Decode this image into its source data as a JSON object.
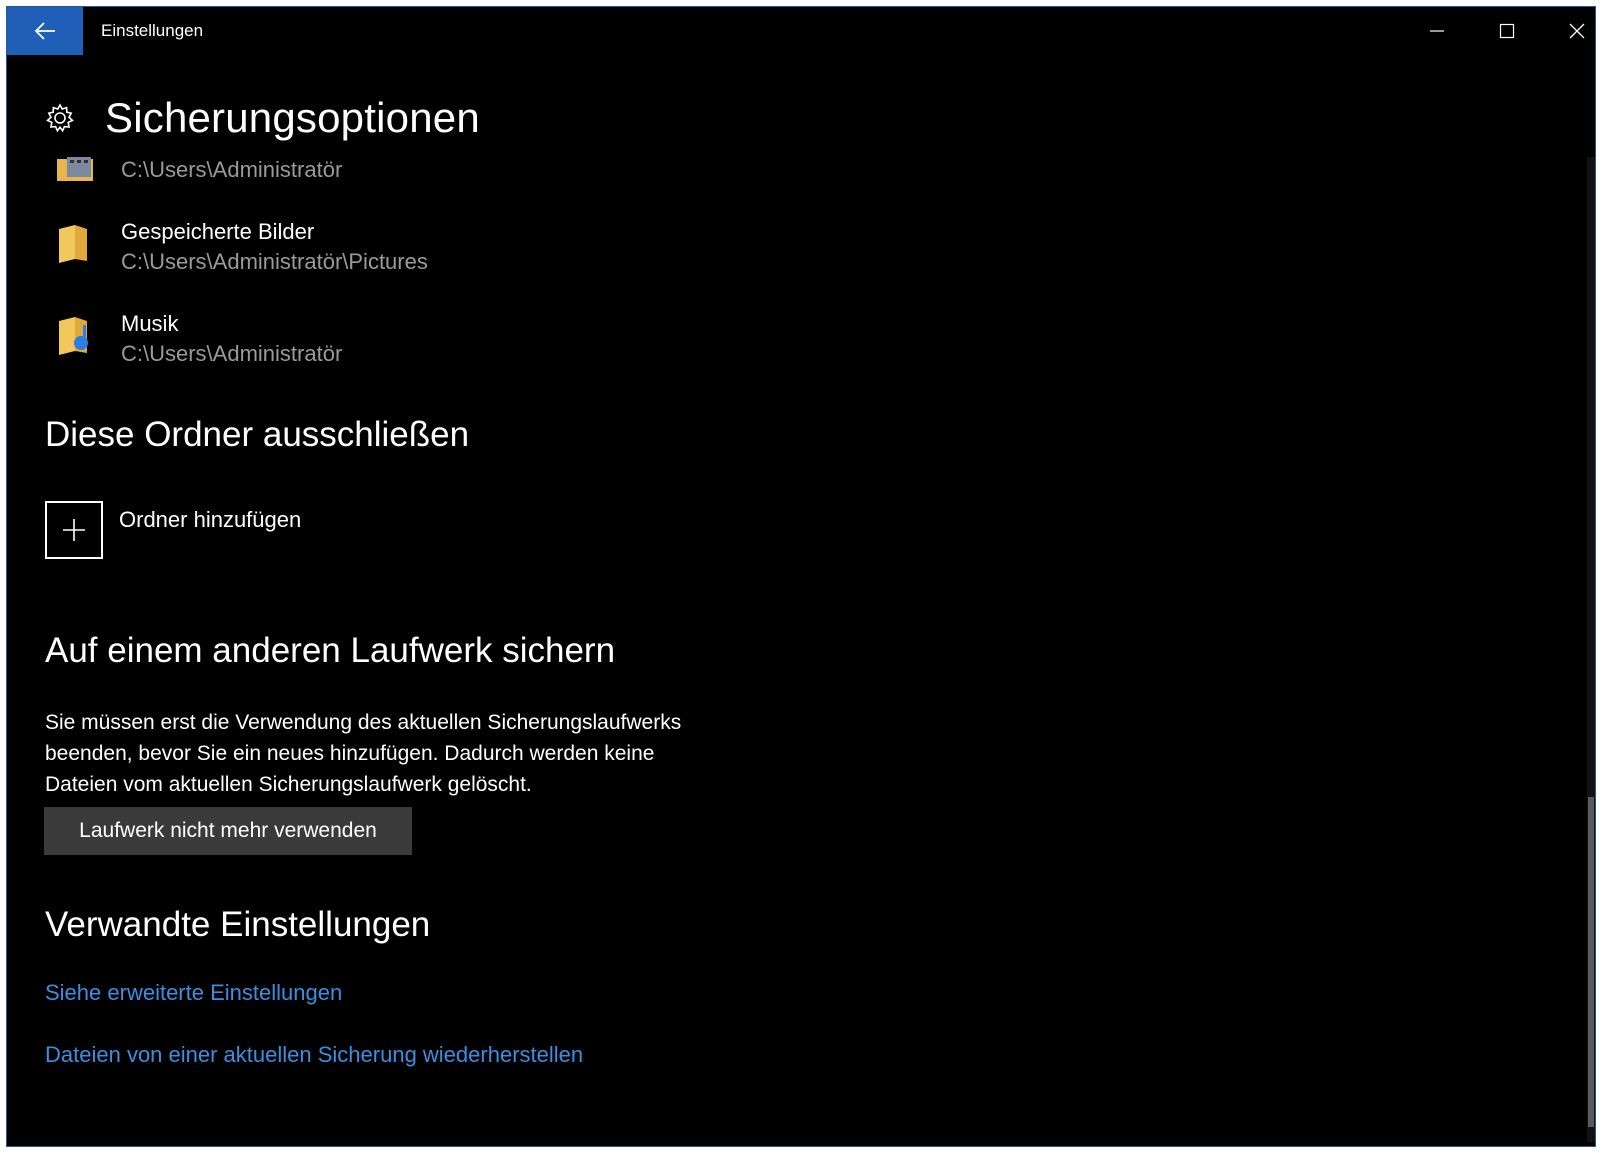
{
  "window": {
    "app_title": "Einstellungen",
    "accent": "#1f5fb8"
  },
  "header": {
    "title": "Sicherungsoptionen"
  },
  "folders": [
    {
      "name": "",
      "path": "C:\\Users\\Administratör",
      "icon": "video-folder-icon"
    },
    {
      "name": "Gespeicherte Bilder",
      "path": "C:\\Users\\Administratör\\Pictures",
      "icon": "folder-icon"
    },
    {
      "name": "Musik",
      "path": "C:\\Users\\Administratör",
      "icon": "music-folder-icon"
    }
  ],
  "exclude": {
    "heading": "Diese Ordner ausschließen",
    "add_label": "Ordner hinzufügen"
  },
  "other_drive": {
    "heading": "Auf einem anderen Laufwerk sichern",
    "description_lines": [
      "Sie müssen erst die Verwendung des aktuellen Sicherungslaufwerks",
      "beenden, bevor Sie ein neues hinzufügen. Dadurch werden keine",
      "Dateien vom aktuellen Sicherungslaufwerk gelöscht."
    ],
    "button_label": "Laufwerk nicht mehr verwenden"
  },
  "related": {
    "heading": "Verwandte Einstellungen",
    "links": [
      "Siehe erweiterte Einstellungen",
      "Dateien von einer aktuellen Sicherung wiederherstellen"
    ],
    "link_color": "#3b8ee0"
  }
}
